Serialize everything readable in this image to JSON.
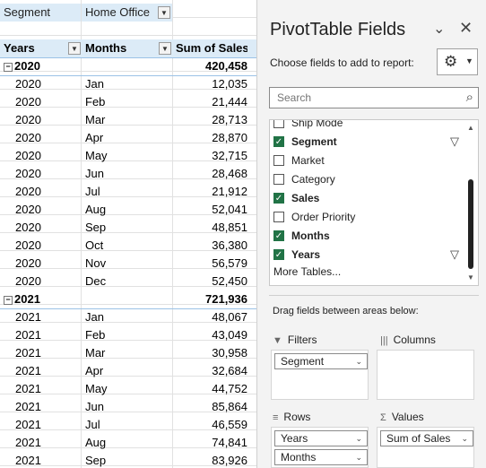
{
  "sheet": {
    "filter_label": "Segment",
    "filter_value": "Home Office",
    "headers": {
      "years": "Years",
      "months": "Months",
      "sum": "Sum of Sales"
    },
    "groups": [
      {
        "year": "2020",
        "total": "420,458",
        "rows": [
          {
            "y": "2020",
            "m": "Jan",
            "v": "12,035"
          },
          {
            "y": "2020",
            "m": "Feb",
            "v": "21,444"
          },
          {
            "y": "2020",
            "m": "Mar",
            "v": "28,713"
          },
          {
            "y": "2020",
            "m": "Apr",
            "v": "28,870"
          },
          {
            "y": "2020",
            "m": "May",
            "v": "32,715"
          },
          {
            "y": "2020",
            "m": "Jun",
            "v": "28,468"
          },
          {
            "y": "2020",
            "m": "Jul",
            "v": "21,912"
          },
          {
            "y": "2020",
            "m": "Aug",
            "v": "52,041"
          },
          {
            "y": "2020",
            "m": "Sep",
            "v": "48,851"
          },
          {
            "y": "2020",
            "m": "Oct",
            "v": "36,380"
          },
          {
            "y": "2020",
            "m": "Nov",
            "v": "56,579"
          },
          {
            "y": "2020",
            "m": "Dec",
            "v": "52,450"
          }
        ]
      },
      {
        "year": "2021",
        "total": "721,936",
        "rows": [
          {
            "y": "2021",
            "m": "Jan",
            "v": "48,067"
          },
          {
            "y": "2021",
            "m": "Feb",
            "v": "43,049"
          },
          {
            "y": "2021",
            "m": "Mar",
            "v": "30,958"
          },
          {
            "y": "2021",
            "m": "Apr",
            "v": "32,684"
          },
          {
            "y": "2021",
            "m": "May",
            "v": "44,752"
          },
          {
            "y": "2021",
            "m": "Jun",
            "v": "85,864"
          },
          {
            "y": "2021",
            "m": "Jul",
            "v": "46,559"
          },
          {
            "y": "2021",
            "m": "Aug",
            "v": "74,841"
          },
          {
            "y": "2021",
            "m": "Sep",
            "v": "83,926"
          }
        ]
      }
    ]
  },
  "pane": {
    "title": "PivotTable Fields",
    "choose_label": "Choose fields to add to report:",
    "search_placeholder": "Search",
    "fields": [
      {
        "label": "Ship Mode",
        "checked": false,
        "bold": false,
        "filter": false
      },
      {
        "label": "Segment",
        "checked": true,
        "bold": true,
        "filter": true
      },
      {
        "label": "Market",
        "checked": false,
        "bold": false,
        "filter": false
      },
      {
        "label": "Category",
        "checked": false,
        "bold": false,
        "filter": false
      },
      {
        "label": "Sales",
        "checked": true,
        "bold": true,
        "filter": false
      },
      {
        "label": "Order Priority",
        "checked": false,
        "bold": false,
        "filter": false
      },
      {
        "label": "Months",
        "checked": true,
        "bold": true,
        "filter": false
      },
      {
        "label": "Years",
        "checked": true,
        "bold": true,
        "filter": true
      }
    ],
    "more_tables": "More Tables...",
    "drag_note": "Drag fields between areas below:",
    "areas": {
      "filters": {
        "label": "Filters",
        "items": [
          "Segment"
        ]
      },
      "columns": {
        "label": "Columns",
        "items": []
      },
      "rows": {
        "label": "Rows",
        "items": [
          "Years",
          "Months"
        ]
      },
      "values": {
        "label": "Values",
        "items": [
          "Sum of Sales"
        ]
      }
    },
    "icons": {
      "close": "chevron-down-icon",
      "x": "close-icon",
      "settings": "gear-icon",
      "search": "search-icon",
      "filter": "funnel-icon"
    },
    "accent_color": "#217346"
  }
}
